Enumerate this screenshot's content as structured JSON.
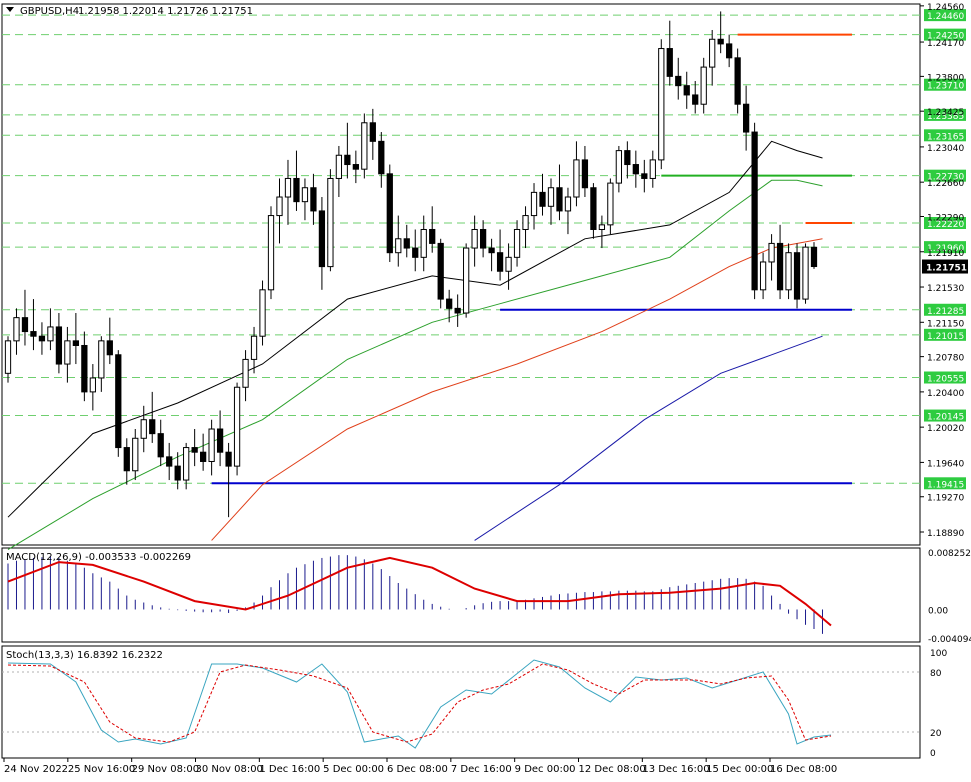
{
  "header": {
    "symbol": "GBPUSD,H4",
    "ohlc": "1.21958 1.22014 1.21726 1.21751"
  },
  "macd": {
    "label": "MACD(12,26,9) -0.003533 -0.002269",
    "axis": [
      "0.008252",
      "0.00",
      "-0.004094"
    ]
  },
  "stoch": {
    "label": "Stoch(13,3,3) 16.8392 16.2322",
    "axis": [
      "100",
      "80",
      "20",
      "0"
    ]
  },
  "colors": {
    "candle": "#000000",
    "grid_level": "#6fcf6f",
    "support": "#0000cd",
    "resistance": "#ff4500",
    "ma_black": "#000000",
    "ma_green": "#2ca02c",
    "ma_red": "#e0401a",
    "ma_blue": "#1a1aa8",
    "macd_signal": "#dd0000",
    "macd_hist": "#1a1a8c",
    "stoch_main": "#3aa5c0",
    "stoch_signal": "#dd0000",
    "label_green_bg": "#2ecc40",
    "price_tag_bg": "#000000"
  },
  "chart_data": [
    {
      "type": "candlestick",
      "title": "GBPUSD,H4",
      "ylim": [
        1.1875,
        1.2458
      ],
      "price_axis_labels": [
        "1.24560",
        "1.24170",
        "1.23800",
        "1.23425",
        "1.23040",
        "1.22660",
        "1.22290",
        "1.21910",
        "1.21530",
        "1.21150",
        "1.20780",
        "1.20400",
        "1.20020",
        "1.19640",
        "1.19270",
        "1.18890"
      ],
      "level_labels": [
        "1.24460",
        "1.24250",
        "1.23710",
        "1.23385",
        "1.23165",
        "1.22730",
        "1.22220",
        "1.21960",
        "1.21285",
        "1.21015",
        "1.20555",
        "1.20145",
        "1.19415"
      ],
      "current_price": "1.21751",
      "time_labels": [
        "24 Nov 2022",
        "25 Nov 16:00",
        "29 Nov 08:00",
        "30 Nov 08:00",
        "1 Dec 16:00",
        "5 Dec 00:00",
        "6 Dec 08:00",
        "7 Dec 16:00",
        "9 Dec 00:00",
        "12 Dec 08:00",
        "13 Dec 16:00",
        "15 Dec 00:00",
        "16 Dec 08:00"
      ],
      "support_levels": [
        1.21285,
        1.19415
      ],
      "resistance_levels": [
        1.2425,
        1.2222
      ],
      "green_level_line": 1.2273,
      "candles": [
        [
          1.206,
          1.21,
          1.205,
          1.2095
        ],
        [
          1.2095,
          1.213,
          1.208,
          1.212
        ],
        [
          1.212,
          1.215,
          1.209,
          1.2105
        ],
        [
          1.2105,
          1.214,
          1.2085,
          1.21
        ],
        [
          1.21,
          1.2115,
          1.208,
          1.2095
        ],
        [
          1.2095,
          1.213,
          1.2085,
          1.211
        ],
        [
          1.211,
          1.2125,
          1.206,
          1.207
        ],
        [
          1.207,
          1.211,
          1.205,
          1.2095
        ],
        [
          1.2095,
          1.2125,
          1.207,
          1.209
        ],
        [
          1.209,
          1.2105,
          1.203,
          1.204
        ],
        [
          1.204,
          1.207,
          1.202,
          1.2055
        ],
        [
          1.2055,
          1.21,
          1.204,
          1.2095
        ],
        [
          1.2095,
          1.212,
          1.207,
          1.208
        ],
        [
          1.208,
          1.2085,
          1.197,
          1.198
        ],
        [
          1.198,
          1.199,
          1.194,
          1.1955
        ],
        [
          1.1955,
          1.2,
          1.1945,
          1.199
        ],
        [
          1.199,
          1.2025,
          1.1975,
          1.201
        ],
        [
          1.201,
          1.204,
          1.1985,
          1.1995
        ],
        [
          1.1995,
          1.201,
          1.196,
          1.197
        ],
        [
          1.197,
          1.1985,
          1.1945,
          1.196
        ],
        [
          1.196,
          1.1975,
          1.1935,
          1.1945
        ],
        [
          1.1945,
          1.1985,
          1.1935,
          1.198
        ],
        [
          1.198,
          1.2,
          1.196,
          1.1975
        ],
        [
          1.1975,
          1.1995,
          1.1955,
          1.1965
        ],
        [
          1.1965,
          1.201,
          1.195,
          1.2
        ],
        [
          1.2,
          1.202,
          1.196,
          1.1975
        ],
        [
          1.1975,
          1.1985,
          1.1905,
          1.196
        ],
        [
          1.196,
          1.205,
          1.195,
          1.2045
        ],
        [
          1.2045,
          1.2085,
          1.203,
          1.2075
        ],
        [
          1.2075,
          1.211,
          1.206,
          1.21
        ],
        [
          1.21,
          1.216,
          1.209,
          1.215
        ],
        [
          1.215,
          1.224,
          1.214,
          1.223
        ],
        [
          1.223,
          1.227,
          1.22,
          1.225
        ],
        [
          1.225,
          1.229,
          1.222,
          1.227
        ],
        [
          1.227,
          1.23,
          1.2235,
          1.2245
        ],
        [
          1.2245,
          1.227,
          1.2225,
          1.226
        ],
        [
          1.226,
          1.2275,
          1.222,
          1.2235
        ],
        [
          1.2235,
          1.225,
          1.215,
          1.2175
        ],
        [
          1.2175,
          1.228,
          1.217,
          1.227
        ],
        [
          1.227,
          1.2305,
          1.225,
          1.2295
        ],
        [
          1.2295,
          1.233,
          1.227,
          1.2285
        ],
        [
          1.2285,
          1.23,
          1.2265,
          1.228
        ],
        [
          1.228,
          1.234,
          1.227,
          1.233
        ],
        [
          1.233,
          1.2345,
          1.229,
          1.231
        ],
        [
          1.231,
          1.232,
          1.226,
          1.2275
        ],
        [
          1.2275,
          1.2285,
          1.218,
          1.219
        ],
        [
          1.219,
          1.223,
          1.2175,
          1.2205
        ],
        [
          1.2205,
          1.222,
          1.2185,
          1.2195
        ],
        [
          1.2195,
          1.2215,
          1.217,
          1.2185
        ],
        [
          1.2185,
          1.223,
          1.217,
          1.2215
        ],
        [
          1.2215,
          1.224,
          1.219,
          1.22
        ],
        [
          1.22,
          1.2205,
          1.213,
          1.214
        ],
        [
          1.214,
          1.215,
          1.2115,
          1.213
        ],
        [
          1.213,
          1.2145,
          1.211,
          1.2125
        ],
        [
          1.2125,
          1.22,
          1.212,
          1.2195
        ],
        [
          1.2195,
          1.223,
          1.2175,
          1.2215
        ],
        [
          1.2215,
          1.2225,
          1.2185,
          1.2195
        ],
        [
          1.2195,
          1.2205,
          1.217,
          1.219
        ],
        [
          1.219,
          1.2215,
          1.216,
          1.217
        ],
        [
          1.217,
          1.22,
          1.215,
          1.2185
        ],
        [
          1.2185,
          1.2225,
          1.2175,
          1.2215
        ],
        [
          1.2215,
          1.224,
          1.2195,
          1.223
        ],
        [
          1.223,
          1.2265,
          1.2215,
          1.2255
        ],
        [
          1.2255,
          1.2275,
          1.223,
          1.224
        ],
        [
          1.224,
          1.227,
          1.222,
          1.226
        ],
        [
          1.226,
          1.2285,
          1.2225,
          1.2235
        ],
        [
          1.2235,
          1.226,
          1.221,
          1.225
        ],
        [
          1.225,
          1.231,
          1.224,
          1.229
        ],
        [
          1.229,
          1.2305,
          1.225,
          1.226
        ],
        [
          1.226,
          1.2265,
          1.2205,
          1.2215
        ],
        [
          1.2215,
          1.223,
          1.2195,
          1.222
        ],
        [
          1.222,
          1.227,
          1.221,
          1.2265
        ],
        [
          1.2265,
          1.2305,
          1.2255,
          1.23
        ],
        [
          1.23,
          1.231,
          1.227,
          1.2285
        ],
        [
          1.2285,
          1.23,
          1.226,
          1.2275
        ],
        [
          1.2275,
          1.229,
          1.2255,
          1.227
        ],
        [
          1.227,
          1.23,
          1.226,
          1.229
        ],
        [
          1.229,
          1.242,
          1.228,
          1.241
        ],
        [
          1.241,
          1.244,
          1.237,
          1.238
        ],
        [
          1.238,
          1.24,
          1.2355,
          1.237
        ],
        [
          1.237,
          1.2385,
          1.2345,
          1.236
        ],
        [
          1.236,
          1.2375,
          1.234,
          1.235
        ],
        [
          1.235,
          1.24,
          1.234,
          1.239
        ],
        [
          1.239,
          1.243,
          1.237,
          1.242
        ],
        [
          1.242,
          1.245,
          1.2405,
          1.2415
        ],
        [
          1.2415,
          1.2425,
          1.239,
          1.24
        ],
        [
          1.24,
          1.241,
          1.234,
          1.235
        ],
        [
          1.235,
          1.237,
          1.23,
          1.232
        ],
        [
          1.232,
          1.233,
          1.214,
          1.215
        ],
        [
          1.215,
          1.219,
          1.214,
          1.218
        ],
        [
          1.218,
          1.221,
          1.216,
          1.22
        ],
        [
          1.22,
          1.222,
          1.214,
          1.215
        ],
        [
          1.215,
          1.22,
          1.214,
          1.219
        ],
        [
          1.219,
          1.22,
          1.213,
          1.214
        ],
        [
          1.214,
          1.22,
          1.2135,
          1.2196
        ],
        [
          1.21958,
          1.22014,
          1.21726,
          1.21751
        ]
      ],
      "moving_averages": [
        {
          "color": "black",
          "values": [
            [
              0,
              1.1905
            ],
            [
              10,
              1.1995
            ],
            [
              20,
              1.2028
            ],
            [
              30,
              1.207
            ],
            [
              40,
              1.214
            ],
            [
              50,
              1.2165
            ],
            [
              58,
              1.2155
            ],
            [
              68,
              1.2205
            ],
            [
              78,
              1.222
            ],
            [
              85,
              1.2255
            ],
            [
              90,
              1.231
            ],
            [
              93,
              1.23
            ],
            [
              96,
              1.2292
            ]
          ]
        },
        {
          "color": "green",
          "values": [
            [
              0,
              1.187
            ],
            [
              10,
              1.1925
            ],
            [
              20,
              1.197
            ],
            [
              30,
              1.201
            ],
            [
              40,
              1.2075
            ],
            [
              50,
              1.2115
            ],
            [
              58,
              1.2135
            ],
            [
              68,
              1.216
            ],
            [
              78,
              1.2185
            ],
            [
              85,
              1.2235
            ],
            [
              90,
              1.2268
            ],
            [
              93,
              1.2268
            ],
            [
              96,
              1.2262
            ]
          ]
        },
        {
          "color": "red",
          "values": [
            [
              24,
              1.188
            ],
            [
              30,
              1.194
            ],
            [
              40,
              1.2
            ],
            [
              50,
              1.204
            ],
            [
              60,
              1.207
            ],
            [
              70,
              1.2105
            ],
            [
              78,
              1.214
            ],
            [
              85,
              1.2175
            ],
            [
              90,
              1.2195
            ],
            [
              96,
              1.2205
            ]
          ]
        },
        {
          "color": "blue",
          "values": [
            [
              55,
              1.188
            ],
            [
              65,
              1.194
            ],
            [
              75,
              1.201
            ],
            [
              84,
              1.206
            ],
            [
              90,
              1.208
            ],
            [
              96,
              1.21
            ]
          ]
        }
      ],
      "macd_histogram": [
        0.0066,
        0.007,
        0.0072,
        0.0074,
        0.0075,
        0.0076,
        0.0074,
        0.007,
        0.0066,
        0.006,
        0.0052,
        0.0046,
        0.004,
        0.003,
        0.002,
        0.0014,
        0.001,
        0.0006,
        0.0003,
        0.0001,
        -0.0001,
        -0.0002,
        -0.0003,
        -0.0004,
        -0.0004,
        -0.0003,
        -0.0005,
        -0.0002,
        0.0003,
        0.001,
        0.002,
        0.0032,
        0.0042,
        0.0052,
        0.006,
        0.0065,
        0.007,
        0.0074,
        0.0076,
        0.0078,
        0.0078,
        0.0076,
        0.0072,
        0.0066,
        0.0058,
        0.0048,
        0.0038,
        0.003,
        0.0022,
        0.0014,
        0.0008,
        0.0004,
        0.0001,
        0.0,
        0.0002,
        0.0006,
        0.0009,
        0.0011,
        0.0012,
        0.0012,
        0.0013,
        0.0014,
        0.0016,
        0.0018,
        0.002,
        0.0022,
        0.0023,
        0.0024,
        0.0025,
        0.0025,
        0.0026,
        0.0026,
        0.0027,
        0.0027,
        0.0027,
        0.0026,
        0.0026,
        0.0029,
        0.0032,
        0.0034,
        0.0036,
        0.0038,
        0.004,
        0.0042,
        0.0044,
        0.0045,
        0.0045,
        0.0044,
        0.004,
        0.0034,
        0.002,
        0.0008,
        -0.0006,
        -0.0014,
        -0.0022,
        -0.0028,
        -0.0035
      ],
      "macd_signal": [
        [
          0,
          0.004
        ],
        [
          6,
          0.0068
        ],
        [
          10,
          0.0064
        ],
        [
          16,
          0.004
        ],
        [
          22,
          0.0012
        ],
        [
          28,
          0.0
        ],
        [
          33,
          0.002
        ],
        [
          40,
          0.006
        ],
        [
          45,
          0.0074
        ],
        [
          50,
          0.006
        ],
        [
          55,
          0.003
        ],
        [
          60,
          0.0012
        ],
        [
          66,
          0.0012
        ],
        [
          72,
          0.0022
        ],
        [
          78,
          0.0024
        ],
        [
          84,
          0.003
        ],
        [
          88,
          0.0038
        ],
        [
          91,
          0.0034
        ],
        [
          94,
          0.0008
        ],
        [
          97,
          -0.0023
        ]
      ],
      "stoch_main": [
        [
          0,
          89
        ],
        [
          5,
          88
        ],
        [
          8,
          70
        ],
        [
          11,
          22
        ],
        [
          13,
          10
        ],
        [
          15,
          13
        ],
        [
          18,
          8
        ],
        [
          21,
          14
        ],
        [
          24,
          88
        ],
        [
          27,
          88
        ],
        [
          30,
          84
        ],
        [
          34,
          70
        ],
        [
          37,
          88
        ],
        [
          40,
          60
        ],
        [
          42,
          10
        ],
        [
          46,
          16
        ],
        [
          48,
          4
        ],
        [
          51,
          45
        ],
        [
          54,
          62
        ],
        [
          57,
          58
        ],
        [
          62,
          92
        ],
        [
          65,
          85
        ],
        [
          68,
          64
        ],
        [
          71,
          50
        ],
        [
          74,
          75
        ],
        [
          77,
          72
        ],
        [
          80,
          74
        ],
        [
          83,
          64
        ],
        [
          86,
          72
        ],
        [
          89,
          80
        ],
        [
          92,
          38
        ],
        [
          93,
          8
        ],
        [
          95,
          15
        ],
        [
          97,
          17
        ]
      ],
      "stoch_signal": [
        [
          0,
          87
        ],
        [
          5,
          86
        ],
        [
          9,
          70
        ],
        [
          12,
          30
        ],
        [
          15,
          14
        ],
        [
          19,
          10
        ],
        [
          22,
          20
        ],
        [
          25,
          80
        ],
        [
          28,
          87
        ],
        [
          32,
          82
        ],
        [
          36,
          76
        ],
        [
          40,
          64
        ],
        [
          43,
          20
        ],
        [
          47,
          10
        ],
        [
          50,
          18
        ],
        [
          53,
          50
        ],
        [
          56,
          62
        ],
        [
          59,
          68
        ],
        [
          63,
          88
        ],
        [
          66,
          82
        ],
        [
          69,
          68
        ],
        [
          72,
          58
        ],
        [
          75,
          72
        ],
        [
          78,
          72
        ],
        [
          81,
          72
        ],
        [
          84,
          68
        ],
        [
          87,
          74
        ],
        [
          90,
          76
        ],
        [
          92,
          52
        ],
        [
          94,
          12
        ],
        [
          97,
          16
        ]
      ]
    }
  ]
}
